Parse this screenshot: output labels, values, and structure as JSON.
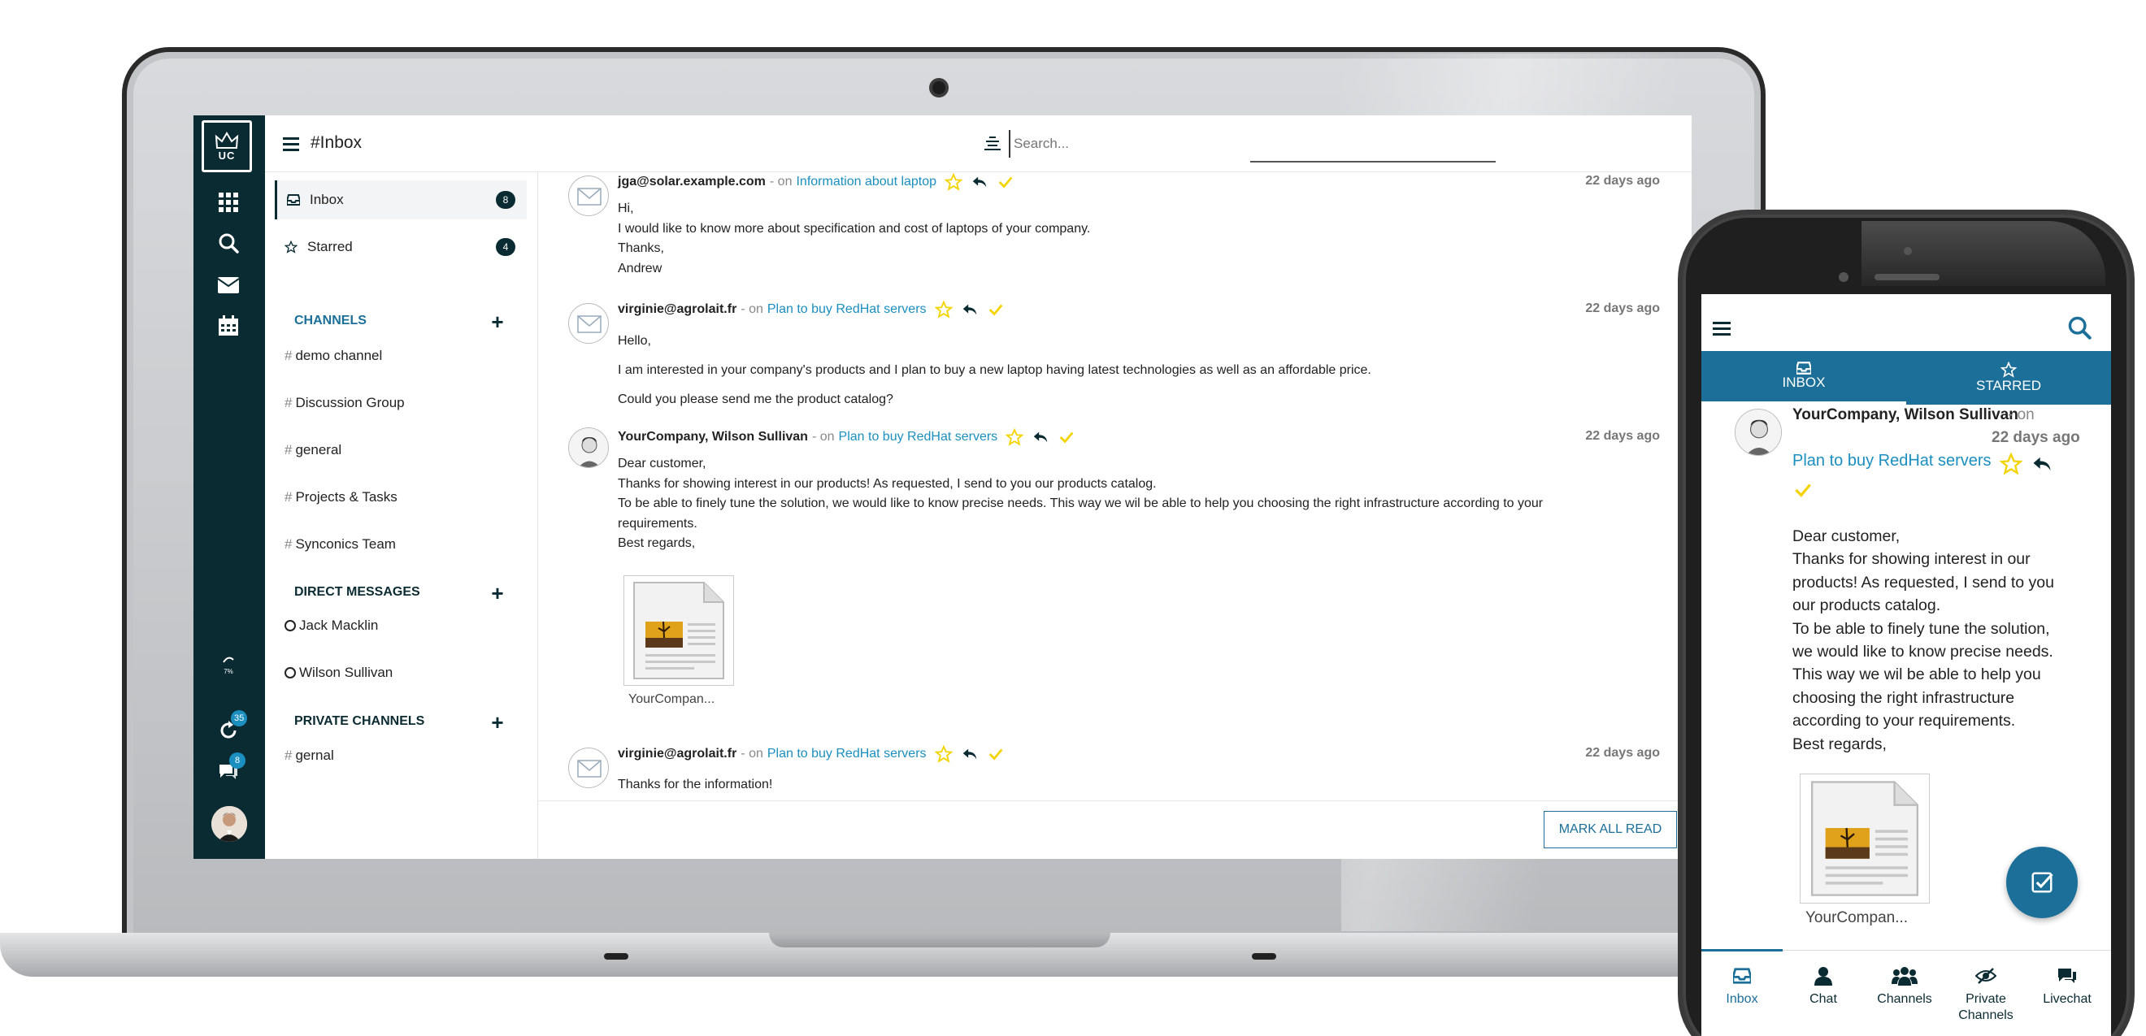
{
  "app": {
    "logo_text": "UC",
    "colors": {
      "rail": "#0b2b33",
      "accent": "#1b6f99",
      "link": "#1b8fbf",
      "star": "#f3d400"
    }
  },
  "rail": {
    "icons": [
      "apps-grid-icon",
      "search-icon",
      "mail-icon",
      "calendar-icon"
    ],
    "stat_label": "7%",
    "refresh_badge": "35",
    "chat_badge": "8"
  },
  "topbar": {
    "title": "#Inbox",
    "search_placeholder": "Search..."
  },
  "sidebar": {
    "inbox": {
      "label": "Inbox",
      "count": "8"
    },
    "starred": {
      "label": "Starred",
      "count": "4"
    },
    "channels_header": "CHANNELS",
    "channels": [
      "demo channel",
      "Discussion Group",
      "general",
      "Projects & Tasks",
      "Synconics Team"
    ],
    "dm_header": "DIRECT MESSAGES",
    "dms": [
      "Jack Macklin",
      "Wilson Sullivan"
    ],
    "private_header": "PRIVATE CHANNELS",
    "private": [
      "gernal"
    ]
  },
  "messages": [
    {
      "author": "jga@solar.example.com",
      "on": "- on",
      "subject": "Information about laptop",
      "date": "22 days ago",
      "lines": [
        "Hi,",
        "I would like to know more about specification and cost of laptops of your company.",
        "Thanks,",
        "Andrew"
      ]
    },
    {
      "author": "virginie@agrolait.fr",
      "on": "- on",
      "subject": "Plan to buy RedHat servers",
      "date": "22 days ago",
      "lines": [
        "Hello,",
        "I am interested in your company's products and I plan to buy a new laptop having latest technologies as well as an affordable price.",
        "Could you please send me the product catalog?"
      ]
    },
    {
      "author": "YourCompany, Wilson Sullivan",
      "on": "- on",
      "subject": "Plan to buy RedHat servers",
      "date": "22 days ago",
      "lines": [
        "Dear customer,",
        "Thanks for showing interest in our products! As requested, I send to you our products catalog.",
        "To be able to finely tune the solution, we would like to know precise needs. This way we wil be able to help you choosing the right infrastructure according to your",
        "requirements.",
        "Best regards,"
      ],
      "attachment": "YourCompan..."
    },
    {
      "author": "virginie@agrolait.fr",
      "on": "- on",
      "subject": "Plan to buy RedHat servers",
      "date": "22 days ago",
      "lines": [
        "Thanks for the information!"
      ]
    }
  ],
  "mark_all_read": "MARK ALL READ",
  "phone": {
    "tabs": [
      "INBOX",
      "STARRED"
    ],
    "author": "YourCompany, Wilson Sullivan",
    "on": "- on",
    "date": "22 days ago",
    "subject": "Plan to buy RedHat servers",
    "body": [
      "Dear customer,",
      "Thanks for showing interest in our",
      "products! As requested, I send to you",
      "our products catalog.",
      "To be able to finely tune the solution,",
      "we would like to know precise needs.",
      "This way we wil be able to help you",
      "choosing the right infrastructure",
      "according to your requirements.",
      "Best regards,"
    ],
    "attachment": "YourCompan...",
    "nav": [
      "Inbox",
      "Chat",
      "Channels",
      "Private Channels",
      "Livechat"
    ]
  }
}
